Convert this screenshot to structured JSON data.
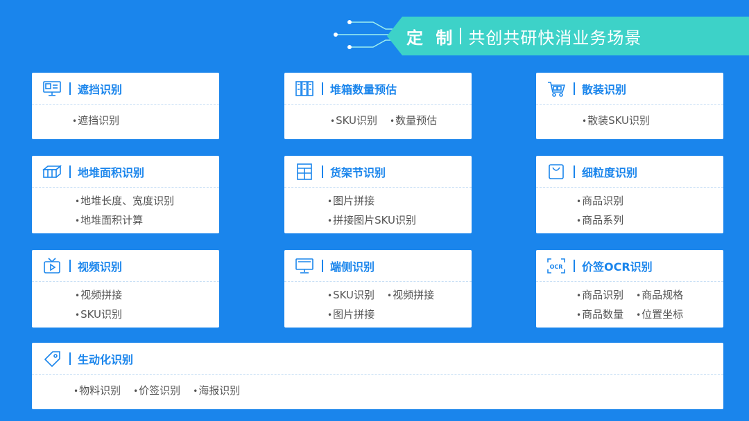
{
  "header": {
    "title_strong": "定 制",
    "title_sub": "共创共研快消业务场景"
  },
  "colors": {
    "background": "#1a85ec",
    "accent": "#1a85ec",
    "banner": "#3dd2c8",
    "card": "#ffffff",
    "item_text": "#555555"
  },
  "cards": [
    {
      "icon": "monitor-display-icon",
      "title": "遮挡识别",
      "rows": [
        [
          "遮挡识别"
        ]
      ]
    },
    {
      "icon": "shelf-boxes-icon",
      "title": "堆箱数量预估",
      "rows": [
        [
          "SKU识别",
          "数量预估"
        ]
      ]
    },
    {
      "icon": "shopping-cart-icon",
      "title": "散装识别",
      "rows": [
        [
          "散装SKU识别"
        ]
      ]
    },
    {
      "icon": "box-stack-icon",
      "title": "地堆面积识别",
      "rows": [
        [
          "地堆长度、宽度识别"
        ],
        [
          "地堆面积计算"
        ]
      ]
    },
    {
      "icon": "shelf-icon",
      "title": "货架节识别",
      "rows": [
        [
          "图片拼接"
        ],
        [
          "拼接图片SKU识别"
        ]
      ]
    },
    {
      "icon": "shopping-bag-icon",
      "title": "细粒度识别",
      "rows": [
        [
          "商品识别"
        ],
        [
          "商品系列"
        ]
      ]
    },
    {
      "icon": "tv-play-icon",
      "title": "视频识别",
      "rows": [
        [
          "视频拼接"
        ],
        [
          "SKU识别"
        ]
      ]
    },
    {
      "icon": "desktop-icon",
      "title": "端侧识别",
      "rows": [
        [
          "SKU识别",
          "视频拼接"
        ],
        [
          "图片拼接"
        ]
      ]
    },
    {
      "icon": "ocr-icon",
      "title": "价签OCR识别",
      "rows": [
        [
          "商品识别",
          "商品规格"
        ],
        [
          "商品数量",
          "位置坐标"
        ]
      ]
    },
    {
      "icon": "price-tag-icon",
      "title": "生动化识别",
      "rows": [
        [
          "物料识别",
          "价签识别",
          "海报识别"
        ]
      ]
    }
  ]
}
